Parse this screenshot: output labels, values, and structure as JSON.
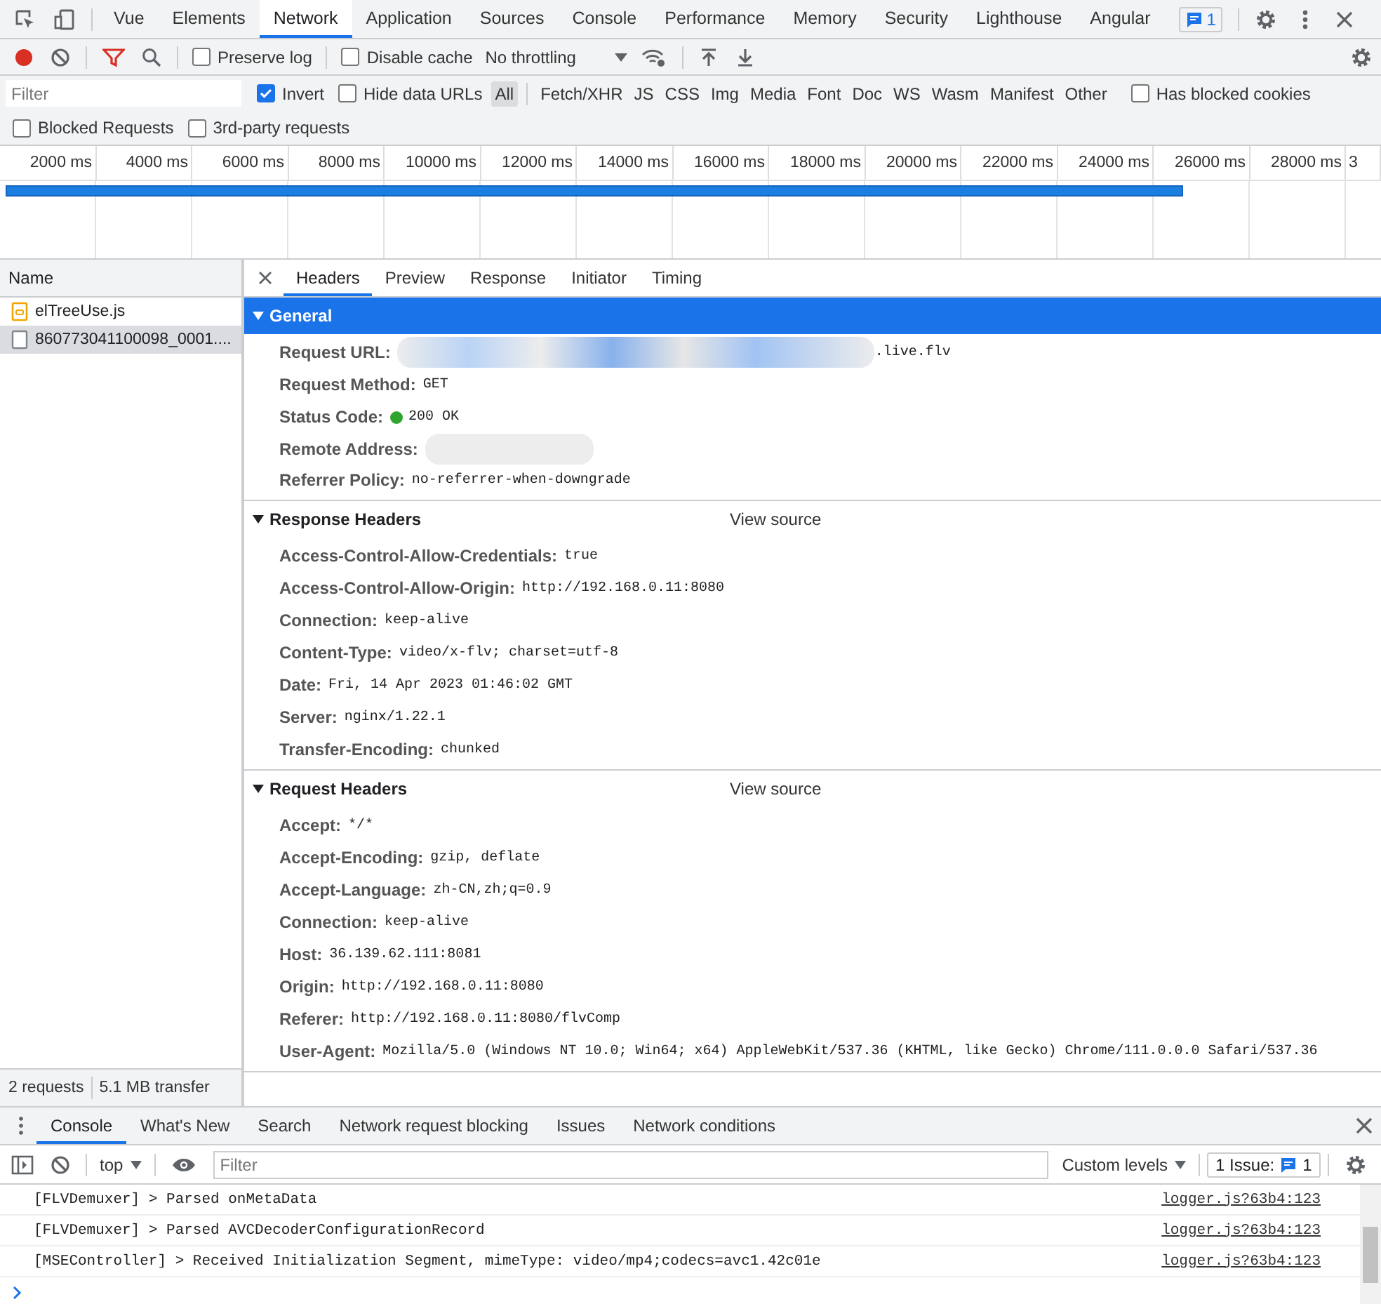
{
  "devtools_tabs": [
    {
      "label": "Vue",
      "selected": false
    },
    {
      "label": "Elements",
      "selected": false
    },
    {
      "label": "Network",
      "selected": true
    },
    {
      "label": "Application",
      "selected": false
    },
    {
      "label": "Sources",
      "selected": false
    },
    {
      "label": "Console",
      "selected": false
    },
    {
      "label": "Performance",
      "selected": false
    },
    {
      "label": "Memory",
      "selected": false
    },
    {
      "label": "Security",
      "selected": false
    },
    {
      "label": "Lighthouse",
      "selected": false
    },
    {
      "label": "Angular",
      "selected": false
    }
  ],
  "issues_badge": "1",
  "toolbar": {
    "recording": true,
    "preserve_log": {
      "label": "Preserve log",
      "checked": false
    },
    "disable_cache": {
      "label": "Disable cache",
      "checked": false
    },
    "throttling": "No throttling"
  },
  "filter": {
    "placeholder": "Filter",
    "invert": {
      "label": "Invert",
      "checked": true
    },
    "hide_data_urls": {
      "label": "Hide data URLs",
      "checked": false
    },
    "types": [
      {
        "label": "All",
        "selected": true
      },
      {
        "label": "Fetch/XHR",
        "selected": false
      },
      {
        "label": "JS",
        "selected": false
      },
      {
        "label": "CSS",
        "selected": false
      },
      {
        "label": "Img",
        "selected": false
      },
      {
        "label": "Media",
        "selected": false
      },
      {
        "label": "Font",
        "selected": false
      },
      {
        "label": "Doc",
        "selected": false
      },
      {
        "label": "WS",
        "selected": false
      },
      {
        "label": "Wasm",
        "selected": false
      },
      {
        "label": "Manifest",
        "selected": false
      },
      {
        "label": "Other",
        "selected": false
      }
    ],
    "has_blocked_cookies": {
      "label": "Has blocked cookies",
      "checked": false
    },
    "blocked_requests": {
      "label": "Blocked Requests",
      "checked": false
    },
    "third_party": {
      "label": "3rd-party requests",
      "checked": false
    }
  },
  "timeline": {
    "ticks": [
      "2000 ms",
      "4000 ms",
      "6000 ms",
      "8000 ms",
      "10000 ms",
      "12000 ms",
      "14000 ms",
      "16000 ms",
      "18000 ms",
      "20000 ms",
      "22000 ms",
      "24000 ms",
      "26000 ms",
      "28000 ms",
      "3"
    ],
    "bar": {
      "level": 0.86
    }
  },
  "requests_header": "Name",
  "requests": [
    {
      "name": "elTreeUse.js",
      "kind": "script",
      "selected": false
    },
    {
      "name": "860773041100098_0001....",
      "kind": "document",
      "selected": true
    }
  ],
  "summary": [
    "2 requests",
    "5.1 MB transfer"
  ],
  "detail_tabs": [
    {
      "label": "Headers",
      "selected": true
    },
    {
      "label": "Preview",
      "selected": false
    },
    {
      "label": "Response",
      "selected": false
    },
    {
      "label": "Initiator",
      "selected": false
    },
    {
      "label": "Timing",
      "selected": false
    }
  ],
  "sections": [
    {
      "title": "General",
      "expanded": true,
      "highlighted": true,
      "rows": [
        {
          "name": "Request URL:",
          "value": ".live.flv",
          "redacted": true
        },
        {
          "name": "Request Method:",
          "value": "GET"
        },
        {
          "name": "Status Code:",
          "value": "200 OK",
          "kind": "status"
        },
        {
          "name": "Remote Address:",
          "redacted": true
        },
        {
          "name": "Referrer Policy:",
          "value": "no-referrer-when-downgrade"
        }
      ]
    },
    {
      "title": "Response Headers",
      "expanded": true,
      "highlighted": false,
      "view_source": "View source",
      "rows": [
        {
          "name": "Access-Control-Allow-Credentials:",
          "value": "true"
        },
        {
          "name": "Access-Control-Allow-Origin:",
          "value": "http://192.168.0.11:8080"
        },
        {
          "name": "Connection:",
          "value": "keep-alive"
        },
        {
          "name": "Content-Type:",
          "value": "video/x-flv; charset=utf-8"
        },
        {
          "name": "Date:",
          "value": "Fri, 14 Apr 2023 01:46:02 GMT"
        },
        {
          "name": "Server:",
          "value": "nginx/1.22.1"
        },
        {
          "name": "Transfer-Encoding:",
          "value": "chunked"
        }
      ]
    },
    {
      "title": "Request Headers",
      "expanded": true,
      "highlighted": false,
      "view_source": "View source",
      "rows": [
        {
          "name": "Accept:",
          "value": "*/*"
        },
        {
          "name": "Accept-Encoding:",
          "value": "gzip, deflate"
        },
        {
          "name": "Accept-Language:",
          "value": "zh-CN,zh;q=0.9"
        },
        {
          "name": "Connection:",
          "value": "keep-alive"
        },
        {
          "name": "Host:",
          "value": "36.139.62.111:8081"
        },
        {
          "name": "Origin:",
          "value": "http://192.168.0.11:8080"
        },
        {
          "name": "Referer:",
          "value": "http://192.168.0.11:8080/flvComp"
        },
        {
          "name": "User-Agent:",
          "value": "Mozilla/5.0 (Windows NT 10.0; Win64; x64) AppleWebKit/537.36 (KHTML, like Gecko) Chrome/111.0.0.0 Safari/537.36"
        }
      ]
    }
  ],
  "drawer_tabs": [
    {
      "label": "Console",
      "selected": true
    },
    {
      "label": "What's New",
      "selected": false
    },
    {
      "label": "Search",
      "selected": false
    },
    {
      "label": "Network request blocking",
      "selected": false
    },
    {
      "label": "Issues",
      "selected": false
    },
    {
      "label": "Network conditions",
      "selected": false
    }
  ],
  "console": {
    "context": "top",
    "filter_placeholder": "Filter",
    "levels": "Custom levels",
    "issues_label": "1 Issue:",
    "issues_count": "1",
    "messages": [
      {
        "text": "[FLVDemuxer] > Parsed onMetaData",
        "source": "logger.js?63b4:123"
      },
      {
        "text": "[FLVDemuxer] > Parsed AVCDecoderConfigurationRecord",
        "source": "logger.js?63b4:123"
      },
      {
        "text": "[MSEController] > Received Initialization Segment, mimeType: video/mp4;codecs=avc1.42c01e",
        "source": "logger.js?63b4:123"
      }
    ]
  }
}
